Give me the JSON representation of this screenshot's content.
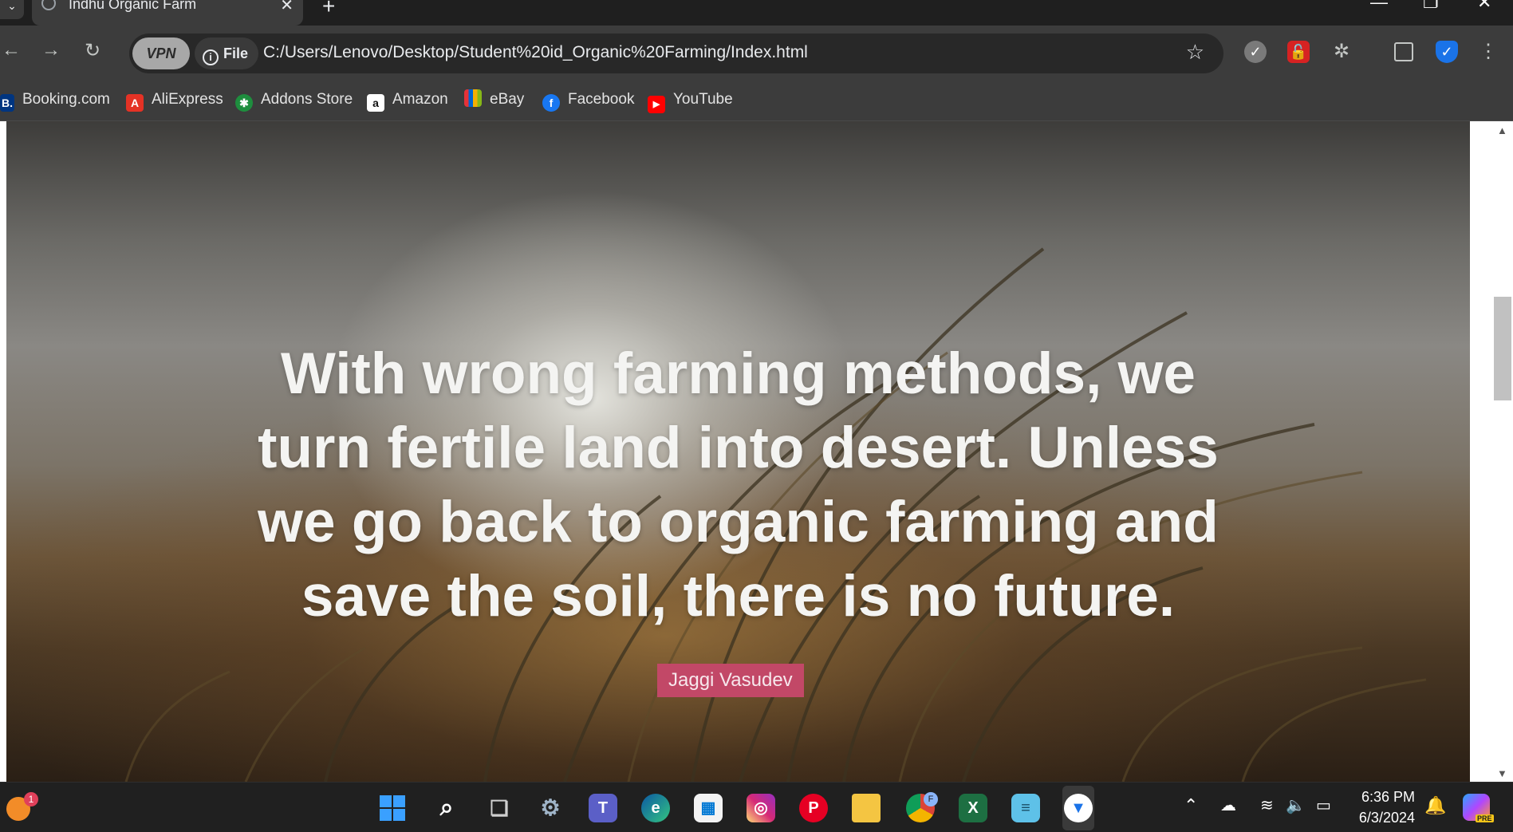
{
  "browser": {
    "tab_title": "Indhu Organic Farm",
    "tab_close": "✕",
    "new_tab": "+",
    "vpn_label": "VPN",
    "file_chip": "File",
    "url": "C:/Users/Lenovo/Desktop/Student%20id_Organic%20Farming/Index.html",
    "bookmarks": [
      {
        "label": "Booking.com",
        "icon": "B.",
        "color": "#003580"
      },
      {
        "label": "AliExpress",
        "icon": "A",
        "color": "#e43225"
      },
      {
        "label": "Addons Store",
        "icon": "✱",
        "color": "#1e8e3e"
      },
      {
        "label": "Amazon",
        "icon": "a",
        "color": "#ffffff"
      },
      {
        "label": "eBay",
        "icon": "e",
        "color": "#e53238"
      },
      {
        "label": "Facebook",
        "icon": "f",
        "color": "#1877f2"
      },
      {
        "label": "YouTube",
        "icon": "▶",
        "color": "#ff0000"
      }
    ]
  },
  "hero": {
    "quote": "With wrong farming methods, we turn fertile land into desert. Unless we go back to organic farming and save the soil, there is no future.",
    "author": "Jaggi Vasudev"
  },
  "taskbar": {
    "notification_count": "1",
    "time": "6:36 PM",
    "date": "6/3/2024",
    "copilot_badge": "PRE",
    "chrome_badge": "F"
  },
  "colors": {
    "author_badge": "#c24867",
    "quote_text": "#f4f4f2",
    "chrome_dark": "#3c3c3c"
  }
}
